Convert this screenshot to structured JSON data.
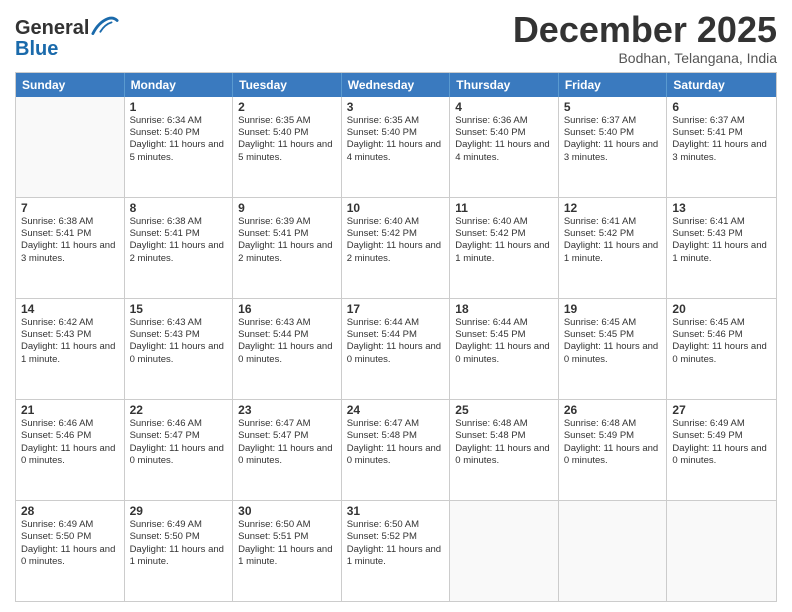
{
  "header": {
    "logo_general": "General",
    "logo_blue": "Blue",
    "month_title": "December 2025",
    "location": "Bodhan, Telangana, India"
  },
  "weekdays": [
    "Sunday",
    "Monday",
    "Tuesday",
    "Wednesday",
    "Thursday",
    "Friday",
    "Saturday"
  ],
  "rows": [
    [
      {
        "day": "",
        "sunrise": "",
        "sunset": "",
        "daylight": ""
      },
      {
        "day": "1",
        "sunrise": "Sunrise: 6:34 AM",
        "sunset": "Sunset: 5:40 PM",
        "daylight": "Daylight: 11 hours and 5 minutes."
      },
      {
        "day": "2",
        "sunrise": "Sunrise: 6:35 AM",
        "sunset": "Sunset: 5:40 PM",
        "daylight": "Daylight: 11 hours and 5 minutes."
      },
      {
        "day": "3",
        "sunrise": "Sunrise: 6:35 AM",
        "sunset": "Sunset: 5:40 PM",
        "daylight": "Daylight: 11 hours and 4 minutes."
      },
      {
        "day": "4",
        "sunrise": "Sunrise: 6:36 AM",
        "sunset": "Sunset: 5:40 PM",
        "daylight": "Daylight: 11 hours and 4 minutes."
      },
      {
        "day": "5",
        "sunrise": "Sunrise: 6:37 AM",
        "sunset": "Sunset: 5:40 PM",
        "daylight": "Daylight: 11 hours and 3 minutes."
      },
      {
        "day": "6",
        "sunrise": "Sunrise: 6:37 AM",
        "sunset": "Sunset: 5:41 PM",
        "daylight": "Daylight: 11 hours and 3 minutes."
      }
    ],
    [
      {
        "day": "7",
        "sunrise": "Sunrise: 6:38 AM",
        "sunset": "Sunset: 5:41 PM",
        "daylight": "Daylight: 11 hours and 3 minutes."
      },
      {
        "day": "8",
        "sunrise": "Sunrise: 6:38 AM",
        "sunset": "Sunset: 5:41 PM",
        "daylight": "Daylight: 11 hours and 2 minutes."
      },
      {
        "day": "9",
        "sunrise": "Sunrise: 6:39 AM",
        "sunset": "Sunset: 5:41 PM",
        "daylight": "Daylight: 11 hours and 2 minutes."
      },
      {
        "day": "10",
        "sunrise": "Sunrise: 6:40 AM",
        "sunset": "Sunset: 5:42 PM",
        "daylight": "Daylight: 11 hours and 2 minutes."
      },
      {
        "day": "11",
        "sunrise": "Sunrise: 6:40 AM",
        "sunset": "Sunset: 5:42 PM",
        "daylight": "Daylight: 11 hours and 1 minute."
      },
      {
        "day": "12",
        "sunrise": "Sunrise: 6:41 AM",
        "sunset": "Sunset: 5:42 PM",
        "daylight": "Daylight: 11 hours and 1 minute."
      },
      {
        "day": "13",
        "sunrise": "Sunrise: 6:41 AM",
        "sunset": "Sunset: 5:43 PM",
        "daylight": "Daylight: 11 hours and 1 minute."
      }
    ],
    [
      {
        "day": "14",
        "sunrise": "Sunrise: 6:42 AM",
        "sunset": "Sunset: 5:43 PM",
        "daylight": "Daylight: 11 hours and 1 minute."
      },
      {
        "day": "15",
        "sunrise": "Sunrise: 6:43 AM",
        "sunset": "Sunset: 5:43 PM",
        "daylight": "Daylight: 11 hours and 0 minutes."
      },
      {
        "day": "16",
        "sunrise": "Sunrise: 6:43 AM",
        "sunset": "Sunset: 5:44 PM",
        "daylight": "Daylight: 11 hours and 0 minutes."
      },
      {
        "day": "17",
        "sunrise": "Sunrise: 6:44 AM",
        "sunset": "Sunset: 5:44 PM",
        "daylight": "Daylight: 11 hours and 0 minutes."
      },
      {
        "day": "18",
        "sunrise": "Sunrise: 6:44 AM",
        "sunset": "Sunset: 5:45 PM",
        "daylight": "Daylight: 11 hours and 0 minutes."
      },
      {
        "day": "19",
        "sunrise": "Sunrise: 6:45 AM",
        "sunset": "Sunset: 5:45 PM",
        "daylight": "Daylight: 11 hours and 0 minutes."
      },
      {
        "day": "20",
        "sunrise": "Sunrise: 6:45 AM",
        "sunset": "Sunset: 5:46 PM",
        "daylight": "Daylight: 11 hours and 0 minutes."
      }
    ],
    [
      {
        "day": "21",
        "sunrise": "Sunrise: 6:46 AM",
        "sunset": "Sunset: 5:46 PM",
        "daylight": "Daylight: 11 hours and 0 minutes."
      },
      {
        "day": "22",
        "sunrise": "Sunrise: 6:46 AM",
        "sunset": "Sunset: 5:47 PM",
        "daylight": "Daylight: 11 hours and 0 minutes."
      },
      {
        "day": "23",
        "sunrise": "Sunrise: 6:47 AM",
        "sunset": "Sunset: 5:47 PM",
        "daylight": "Daylight: 11 hours and 0 minutes."
      },
      {
        "day": "24",
        "sunrise": "Sunrise: 6:47 AM",
        "sunset": "Sunset: 5:48 PM",
        "daylight": "Daylight: 11 hours and 0 minutes."
      },
      {
        "day": "25",
        "sunrise": "Sunrise: 6:48 AM",
        "sunset": "Sunset: 5:48 PM",
        "daylight": "Daylight: 11 hours and 0 minutes."
      },
      {
        "day": "26",
        "sunrise": "Sunrise: 6:48 AM",
        "sunset": "Sunset: 5:49 PM",
        "daylight": "Daylight: 11 hours and 0 minutes."
      },
      {
        "day": "27",
        "sunrise": "Sunrise: 6:49 AM",
        "sunset": "Sunset: 5:49 PM",
        "daylight": "Daylight: 11 hours and 0 minutes."
      }
    ],
    [
      {
        "day": "28",
        "sunrise": "Sunrise: 6:49 AM",
        "sunset": "Sunset: 5:50 PM",
        "daylight": "Daylight: 11 hours and 0 minutes."
      },
      {
        "day": "29",
        "sunrise": "Sunrise: 6:49 AM",
        "sunset": "Sunset: 5:50 PM",
        "daylight": "Daylight: 11 hours and 1 minute."
      },
      {
        "day": "30",
        "sunrise": "Sunrise: 6:50 AM",
        "sunset": "Sunset: 5:51 PM",
        "daylight": "Daylight: 11 hours and 1 minute."
      },
      {
        "day": "31",
        "sunrise": "Sunrise: 6:50 AM",
        "sunset": "Sunset: 5:52 PM",
        "daylight": "Daylight: 11 hours and 1 minute."
      },
      {
        "day": "",
        "sunrise": "",
        "sunset": "",
        "daylight": ""
      },
      {
        "day": "",
        "sunrise": "",
        "sunset": "",
        "daylight": ""
      },
      {
        "day": "",
        "sunrise": "",
        "sunset": "",
        "daylight": ""
      }
    ]
  ]
}
